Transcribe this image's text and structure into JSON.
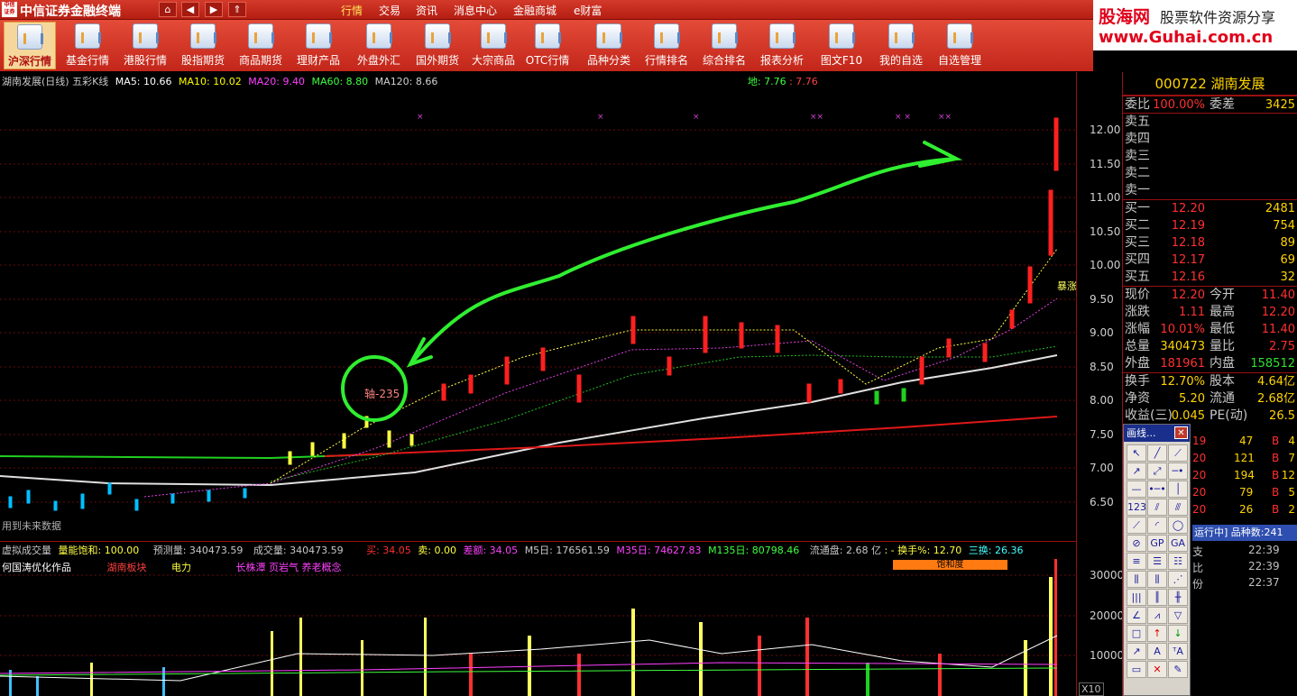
{
  "titlebar": {
    "logo_text": "中信证券",
    "app_title": "中信证券金融终端",
    "menu": [
      "行情",
      "交易",
      "资讯",
      "消息中心",
      "金融商城",
      "e财富"
    ]
  },
  "brand": {
    "name": "股海网",
    "slogan": "股票软件资源分享",
    "url": "www.Guhai.com.cn"
  },
  "toolbar": [
    {
      "label": "沪深行情",
      "active": true
    },
    {
      "label": "基金行情"
    },
    {
      "label": "港股行情"
    },
    {
      "label": "股指期货"
    },
    {
      "label": "商品期货"
    },
    {
      "label": "理财产品"
    },
    {
      "label": "外盘外汇"
    },
    {
      "label": "国外期货"
    },
    {
      "label": "大宗商品"
    },
    {
      "label": "OTC行情"
    },
    {
      "label": "品种分类"
    },
    {
      "label": "行情排名"
    },
    {
      "label": "综合排名"
    },
    {
      "label": "报表分析"
    },
    {
      "label": "图文F10"
    },
    {
      "label": "我的自选"
    },
    {
      "label": "自选管理"
    }
  ],
  "chart_info": {
    "title": "湖南发展(日线) 五彩K线",
    "ma5": "MA5: 10.66",
    "ma10": "MA10: 10.02",
    "ma20": "MA20: 9.40",
    "ma60": "MA60: 8.80",
    "ma120": "MA120: 8.66",
    "di": "地: 7.76",
    "di2": ": 7.76",
    "label_axis": "轴-235",
    "label_future": "用到未来数据",
    "label_baozhang": "暴涨"
  },
  "y_axis": [
    "12.00",
    "11.50",
    "11.00",
    "10.50",
    "10.00",
    "9.50",
    "9.00",
    "8.50",
    "8.00",
    "7.50",
    "7.00",
    "6.50"
  ],
  "vol_info": {
    "line1": [
      "虚拟成交量",
      "量能饱和: 100.00",
      "预测量: 340473.59",
      "成交量: 340473.59",
      "买: 34.05",
      "卖: 0.00",
      "差额: 34.05",
      "M5日: 176561.59",
      "M35日: 74627.83",
      "M135日: 80798.46",
      "流通盘: 2.68 亿",
      ": - 换手%: 12.70",
      "三换: 26.36"
    ],
    "line2": [
      "何国涛优化作品",
      "湖南板块",
      "电力",
      "长株潭 页岩气 养老概念"
    ],
    "saturation_label": "饱和度",
    "vol_axis": [
      "30000",
      "20000",
      "10000"
    ],
    "x10": "X10"
  },
  "quote": {
    "header": "000722 湖南发展",
    "weibi": {
      "k": "委比",
      "v": "100.00%",
      "k2": "委差",
      "v2": "3425"
    },
    "sells": [
      "卖五",
      "卖四",
      "卖三",
      "卖二",
      "卖一"
    ],
    "buys": [
      {
        "k": "买一",
        "v": "12.20",
        "vol": "2481"
      },
      {
        "k": "买二",
        "v": "12.19",
        "vol": "754"
      },
      {
        "k": "买三",
        "v": "12.18",
        "vol": "89"
      },
      {
        "k": "买四",
        "v": "12.17",
        "vol": "69"
      },
      {
        "k": "买五",
        "v": "12.16",
        "vol": "32"
      }
    ],
    "stats": [
      {
        "k": "现价",
        "v": "12.20",
        "k2": "今开",
        "v2": "11.40"
      },
      {
        "k": "涨跌",
        "v": "1.11",
        "k2": "最高",
        "v2": "12.20"
      },
      {
        "k": "涨幅",
        "v": "10.01%",
        "k2": "最低",
        "v2": "11.40"
      },
      {
        "k": "总量",
        "v": "340473",
        "k2": "量比",
        "v2": "2.75"
      },
      {
        "k": "外盘",
        "v": "181961",
        "k2": "内盘",
        "v2": "158512"
      }
    ],
    "stats2": [
      {
        "k": "换手",
        "v": "12.70%",
        "k2": "股本",
        "v2": "4.64亿"
      },
      {
        "k": "净资",
        "v": "5.20",
        "k2": "流通",
        "v2": "2.68亿"
      },
      {
        "k": "收益(三)",
        "v": "0.045",
        "k2": "PE(动)",
        "v2": "26.5"
      }
    ],
    "trades": [
      {
        "p": "19",
        "v": "47",
        "s": "B",
        "n": "4"
      },
      {
        "p": "20",
        "v": "121",
        "s": "B",
        "n": "7"
      },
      {
        "p": "20",
        "v": "194",
        "s": "B",
        "n": "12"
      },
      {
        "p": "20",
        "v": "79",
        "s": "B",
        "n": "5"
      },
      {
        "p": "20",
        "v": "26",
        "s": "B",
        "n": "2"
      }
    ],
    "run_bar": "运行中] 品种数:241",
    "times": [
      {
        "t": "支",
        "v": "22:39"
      },
      {
        "t": "比",
        "v": "22:39"
      },
      {
        "t": "份",
        "v": "22:37"
      }
    ]
  },
  "drawtool": {
    "title": "画线...",
    "close": "✕"
  }
}
